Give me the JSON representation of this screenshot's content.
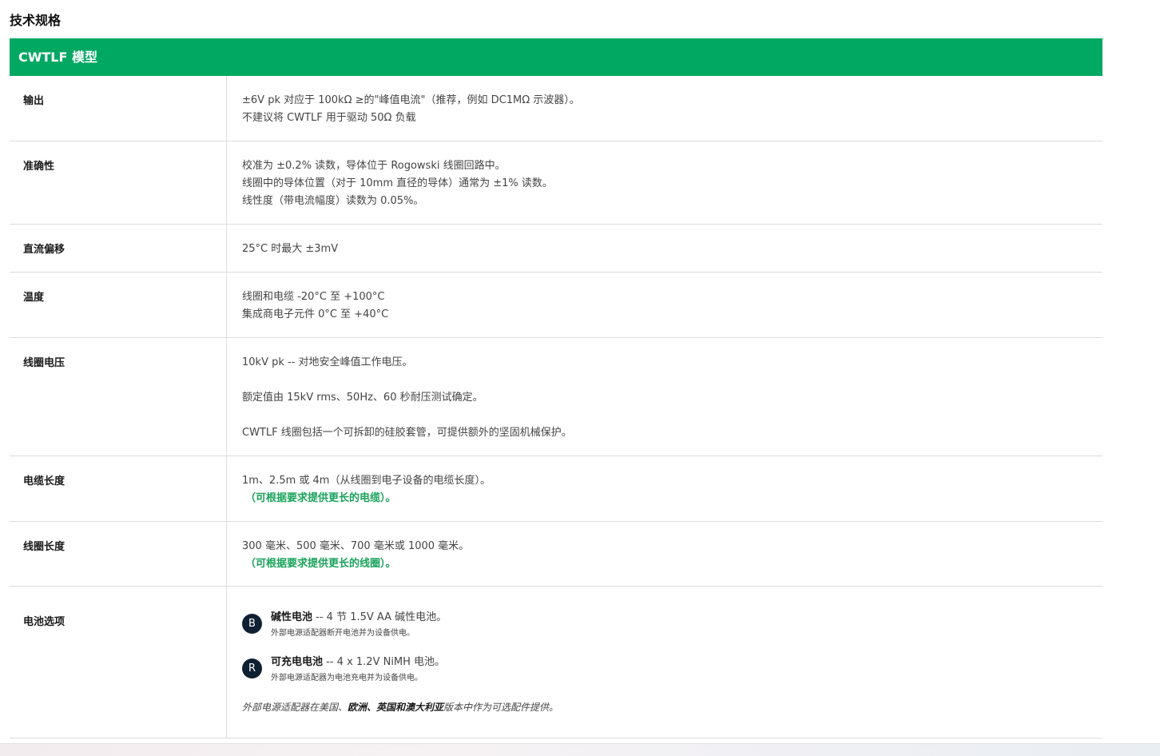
{
  "heading": "技术规格",
  "table": {
    "header": "CWTLF 模型",
    "rows": {
      "output": {
        "label": "输出",
        "lines": [
          "±6V pk 对应于 100kΩ ≥的\"峰值电流\"（推荐，例如 DC1MΩ 示波器）。",
          "不建议将 CWTLF 用于驱动 50Ω 负载"
        ]
      },
      "accuracy": {
        "label": "准确性",
        "lines": [
          "校准为 ±0.2% 读数，导体位于 Rogowski 线圈回路中。",
          "线圈中的导体位置（对于 10mm 直径的导体）通常为 ±1% 读数。",
          "线性度（带电流幅度）读数为 0.05%。"
        ]
      },
      "dc_offset": {
        "label": "直流偏移",
        "lines": [
          "25°C 时最大 ±3mV"
        ]
      },
      "temperature": {
        "label": "温度",
        "lines": [
          "线圈和电缆 -20°C 至 +100°C",
          "集成商电子元件 0°C 至 +40°C"
        ]
      },
      "coil_voltage": {
        "label": "线圈电压",
        "paras": [
          "10kV pk -- 对地安全峰值工作电压。",
          "额定值由 15kV rms、50Hz、60 秒耐压测试确定。",
          "CWTLF 线圈包括一个可拆卸的硅胶套管，可提供额外的坚固机械保护。"
        ]
      },
      "cable_length": {
        "label": "电缆长度",
        "line": "1m、2.5m 或 4m（从线圈到电子设备的电缆长度）。",
        "note": "（可根据要求提供更长的电缆）。"
      },
      "coil_length": {
        "label": "线圈长度",
        "line": "300 毫米、500 毫米、700 毫米或 1000 毫米。",
        "note": "（可根据要求提供更长的线圈）。"
      },
      "battery": {
        "label": "电池选项",
        "items": [
          {
            "badge": "B",
            "title": "碱性电池",
            "desc": " -- 4 节 1.5V AA 碱性电池。",
            "note": "外部电源适配器断开电池并为设备供电。"
          },
          {
            "badge": "R",
            "title": "可充电电池",
            "desc": " -- 4 x 1.2V NiMH 电池。",
            "note": "外部电源适配器为电池充电并为设备供电。"
          }
        ],
        "footnote": {
          "prefix": "外部电源适配器在美国、",
          "bold": "欧洲、英国和澳大利亚",
          "suffix": "版本中作为可选配件提供。"
        }
      }
    }
  },
  "colors": {
    "header_bg": "#00a862",
    "accent_green": "#1aa35b",
    "badge_bg": "#102033"
  }
}
